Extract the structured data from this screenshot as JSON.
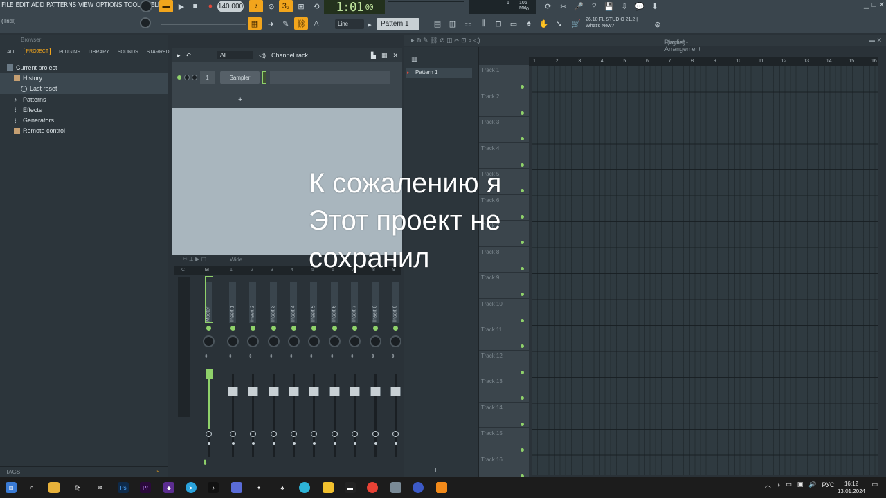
{
  "menu": [
    "FILE",
    "EDIT",
    "ADD",
    "PATTERNS",
    "VIEW",
    "OPTIONS",
    "TOOLS",
    "HELP"
  ],
  "trial": "(Trial)",
  "tempo": "140.000",
  "time": "1:01",
  "time_sub": "00",
  "cpu": {
    "mem": "106 MB",
    "val1": "1",
    "val2": "0"
  },
  "snap": "Line",
  "pattern": "Pattern 1",
  "news": {
    "version": "26.10  FL STUDIO 21.2 |",
    "link": "What's New?"
  },
  "browser": {
    "title": "Browser",
    "tabs": [
      "ALL",
      "PROJECT",
      "PLUGINS",
      "LIBRARY",
      "SOUNDS",
      "STARRED"
    ],
    "active_tab": "PROJECT",
    "tree": [
      {
        "label": "Current project",
        "indent": 0
      },
      {
        "label": "History",
        "indent": 1
      },
      {
        "label": "Last reset",
        "indent": 2
      },
      {
        "label": "Patterns",
        "indent": 1
      },
      {
        "label": "Effects",
        "indent": 1
      },
      {
        "label": "Generators",
        "indent": 1
      },
      {
        "label": "Remote control",
        "indent": 1
      }
    ],
    "tags_label": "TAGS"
  },
  "channel_rack": {
    "title": "Channel rack",
    "filter": "All",
    "channel_number": "1",
    "channel_name": "Sampler",
    "add_label": "+"
  },
  "mixer": {
    "view": "Wide",
    "strips": [
      "Master",
      "Insert 1",
      "Insert 2",
      "Insert 3",
      "Insert 4",
      "Insert 5",
      "Insert 6",
      "Insert 7",
      "Insert 8",
      "Insert 9"
    ],
    "ruler": [
      "C",
      "M",
      "1",
      "2",
      "3",
      "4",
      "5",
      "6",
      "7",
      "8",
      "9"
    ]
  },
  "playlist": {
    "title": "Playlist - Arrangement",
    "pattern_selection": "(none)",
    "picker_item": "Pattern 1",
    "picker_add": "+",
    "bars": [
      "1",
      "2",
      "3",
      "4",
      "5",
      "6",
      "7",
      "8",
      "9",
      "10",
      "11",
      "12",
      "13",
      "14",
      "15",
      "16"
    ],
    "tracks": [
      "Track 1",
      "Track 2",
      "Track 3",
      "Track 4",
      "Track 5",
      "Track 6",
      "Track 7",
      "Track 8",
      "Track 9",
      "Track 10",
      "Track 11",
      "Track 12",
      "Track 13",
      "Track 14",
      "Track 15",
      "Track 16"
    ]
  },
  "caption": [
    "К сожалению я",
    "Этот проект не",
    "сохранил"
  ],
  "taskbar": {
    "lang": "РУС",
    "time": "16:12",
    "date": "13.01.2024"
  },
  "colors": {
    "accent_orange": "#f2a51c",
    "led_green": "#8fd16a",
    "time_bg": "#23311d"
  }
}
